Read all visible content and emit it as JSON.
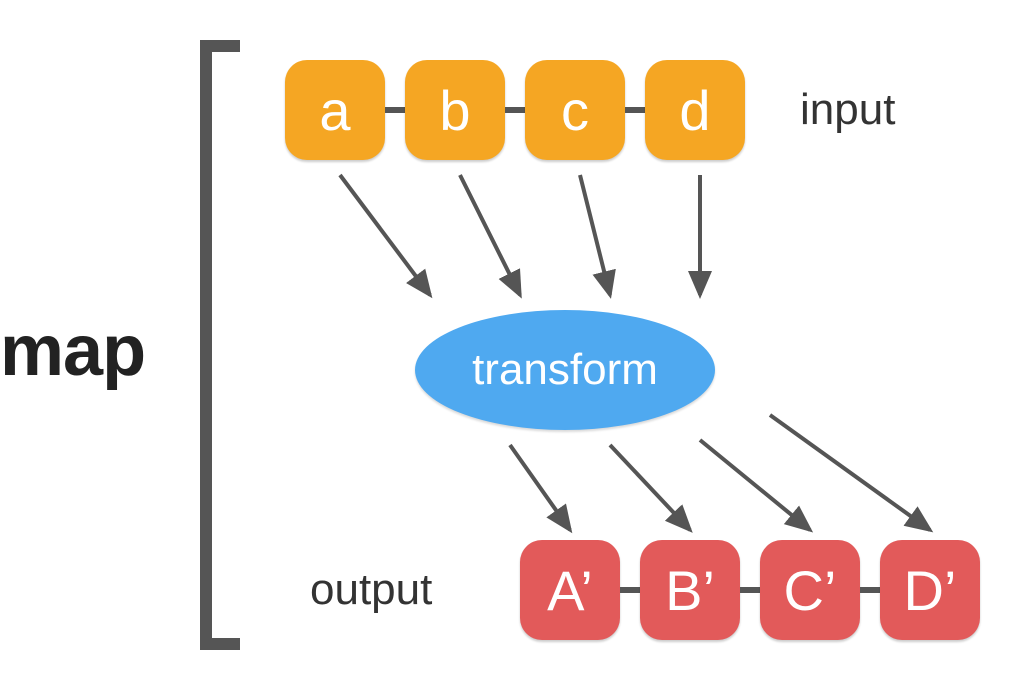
{
  "title": "map",
  "labels": {
    "input": "input",
    "output": "output",
    "transform": "transform"
  },
  "input_nodes": [
    "a",
    "b",
    "c",
    "d"
  ],
  "output_nodes": [
    "A’",
    "B’",
    "C’",
    "D’"
  ],
  "colors": {
    "input_node": "#f5a623",
    "output_node": "#e25a5a",
    "transform": "#4fa9f0",
    "bracket": "#555555",
    "text": "#333333"
  }
}
